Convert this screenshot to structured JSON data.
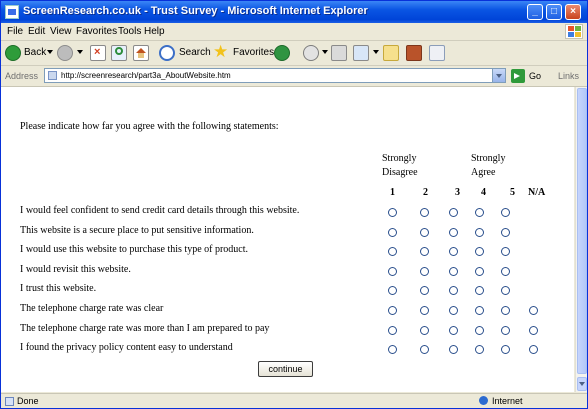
{
  "window": {
    "title": "ScreenResearch.co.uk - Trust Survey - Microsoft Internet Explorer"
  },
  "menu": [
    "File",
    "Edit",
    "View",
    "Favorites",
    "Tools",
    "Help"
  ],
  "toolbar": {
    "back_label": "Back",
    "search_label": "Search",
    "favorites_label": "Favorites"
  },
  "address": {
    "label": "Address",
    "url": "http://screenresearch/part3a_AboutWebsite.htm",
    "go_label": "Go",
    "links_label": "Links"
  },
  "survey": {
    "instruction": "Please indicate how far you agree with the following statements:",
    "header_strongly_disagree": [
      "Strongly",
      "Disagree"
    ],
    "header_strongly_agree": [
      "Strongly",
      "Agree"
    ],
    "scale": [
      "1",
      "2",
      "3",
      "4",
      "5",
      "N/A"
    ],
    "statements": [
      {
        "text": "I would feel confident to send credit card details through this website.",
        "has_na": false
      },
      {
        "text": "This website is a secure place to put sensitive information.",
        "has_na": false
      },
      {
        "text": "I would use this website to purchase this type of product.",
        "has_na": false
      },
      {
        "text": "I would revisit this website.",
        "has_na": false
      },
      {
        "text": "I trust this website.",
        "has_na": false
      },
      {
        "text": "The telephone charge rate was clear",
        "has_na": true
      },
      {
        "text": "The telephone charge rate was more than I am prepared to pay",
        "has_na": true
      },
      {
        "text": "I found the privacy policy content easy to understand",
        "has_na": true
      }
    ],
    "continue_label": "continue"
  },
  "status": {
    "text": "Done",
    "zone": "Internet"
  }
}
